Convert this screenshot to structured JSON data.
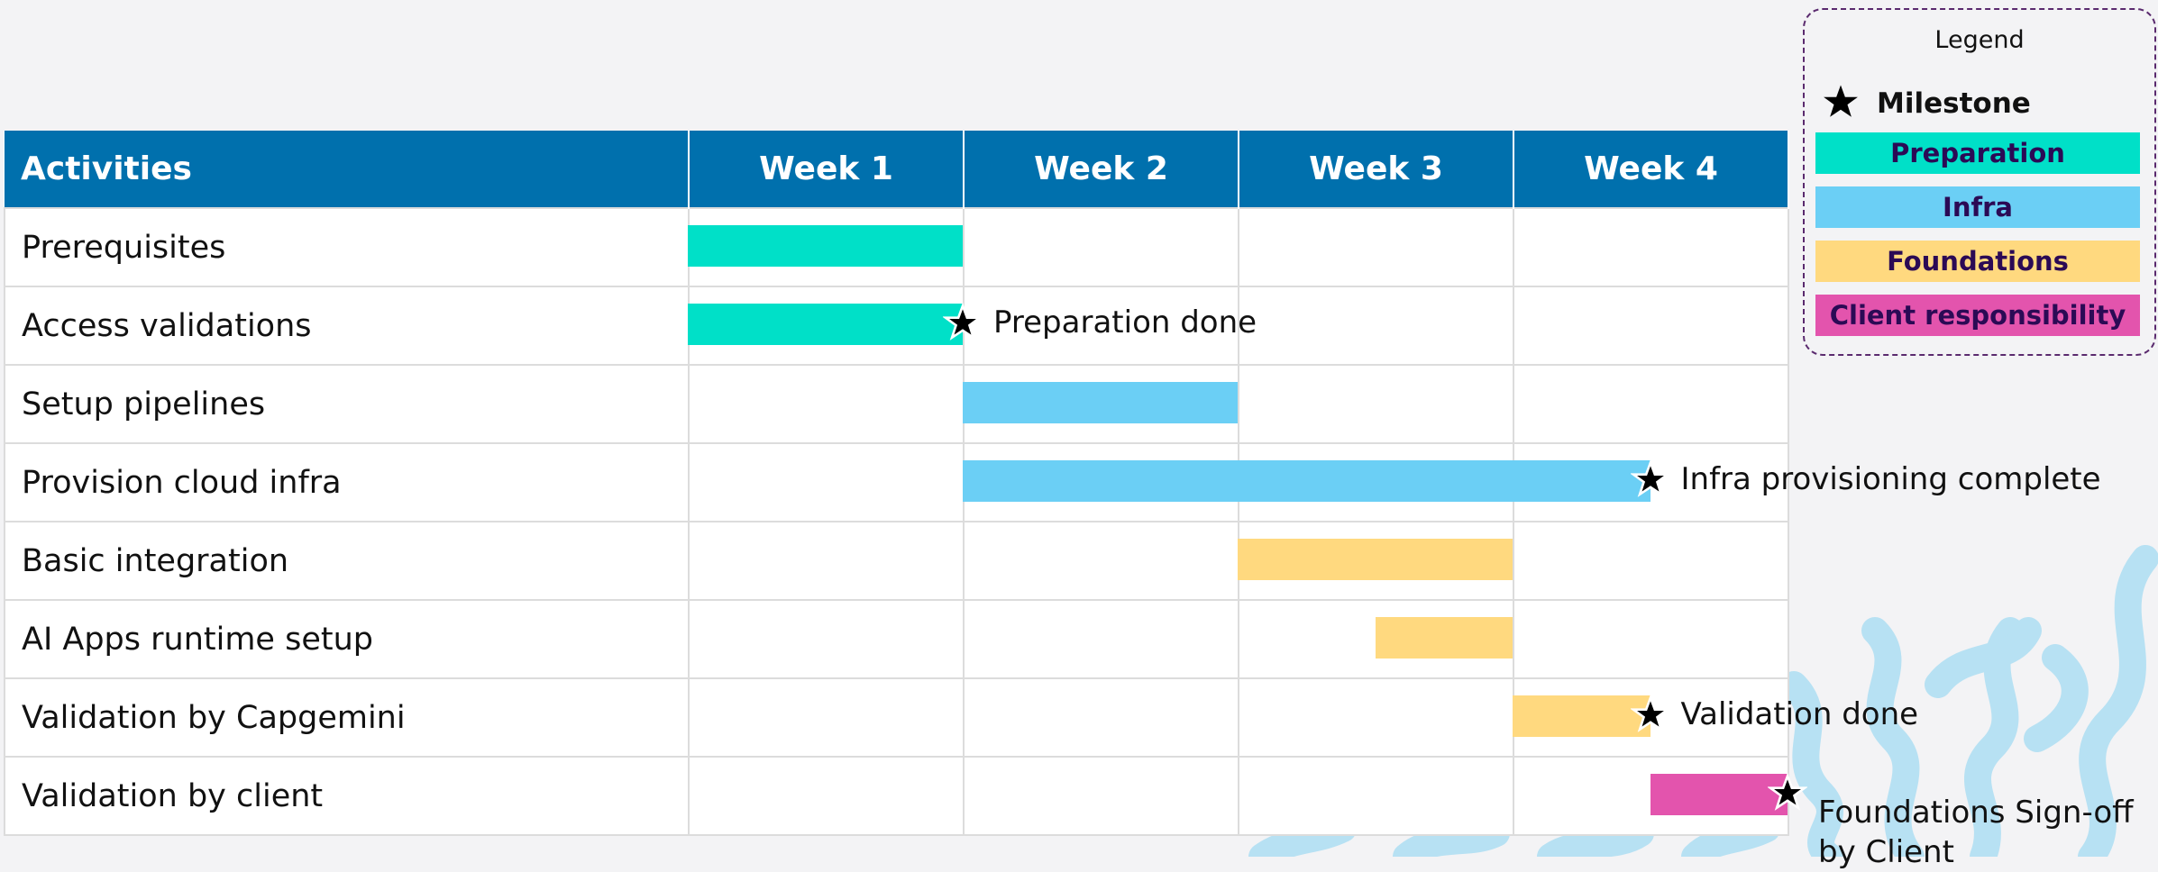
{
  "table": {
    "header": {
      "activities": "Activities",
      "weeks": [
        "Week 1",
        "Week 2",
        "Week 3",
        "Week 4"
      ]
    },
    "rows": [
      {
        "activity": "Prerequisites"
      },
      {
        "activity": "Access validations"
      },
      {
        "activity": "Setup pipelines"
      },
      {
        "activity": "Provision cloud infra"
      },
      {
        "activity": "Basic integration"
      },
      {
        "activity": "AI Apps runtime setup"
      },
      {
        "activity": "Validation by Capgemini"
      },
      {
        "activity": "Validation by client"
      }
    ]
  },
  "tasks": [
    {
      "row": 0,
      "start": 0,
      "end": 1,
      "category": "preparation"
    },
    {
      "row": 1,
      "start": 0,
      "end": 1,
      "category": "preparation"
    },
    {
      "row": 2,
      "start": 1,
      "end": 2,
      "category": "infra"
    },
    {
      "row": 3,
      "start": 1,
      "end": 3.5,
      "category": "infra"
    },
    {
      "row": 4,
      "start": 2,
      "end": 3,
      "category": "foundations"
    },
    {
      "row": 5,
      "start": 2.5,
      "end": 3,
      "category": "foundations"
    },
    {
      "row": 6,
      "start": 3,
      "end": 3.5,
      "category": "foundations"
    },
    {
      "row": 7,
      "start": 3.5,
      "end": 4,
      "category": "client"
    }
  ],
  "milestones": [
    {
      "row": 1,
      "at": 1,
      "label": "Preparation done"
    },
    {
      "row": 3,
      "at": 3.5,
      "label": "Infra provisioning complete"
    },
    {
      "row": 6,
      "at": 3.5,
      "label": "Validation done"
    },
    {
      "row": 7,
      "at": 4,
      "label": "Foundations Sign-off\nby Client"
    }
  ],
  "legend": {
    "title": "Legend",
    "milestone": "Milestone",
    "items": [
      {
        "key": "preparation",
        "label": "Preparation",
        "color": "#00e0c8"
      },
      {
        "key": "infra",
        "label": "Infra",
        "color": "#6bcff5"
      },
      {
        "key": "foundations",
        "label": "Foundations",
        "color": "#ffd97f"
      },
      {
        "key": "client",
        "label": "Client responsibility",
        "color": "#e354ad"
      }
    ]
  },
  "colors": {
    "header": "#0070ad",
    "decoration": "#b7e1f3"
  }
}
